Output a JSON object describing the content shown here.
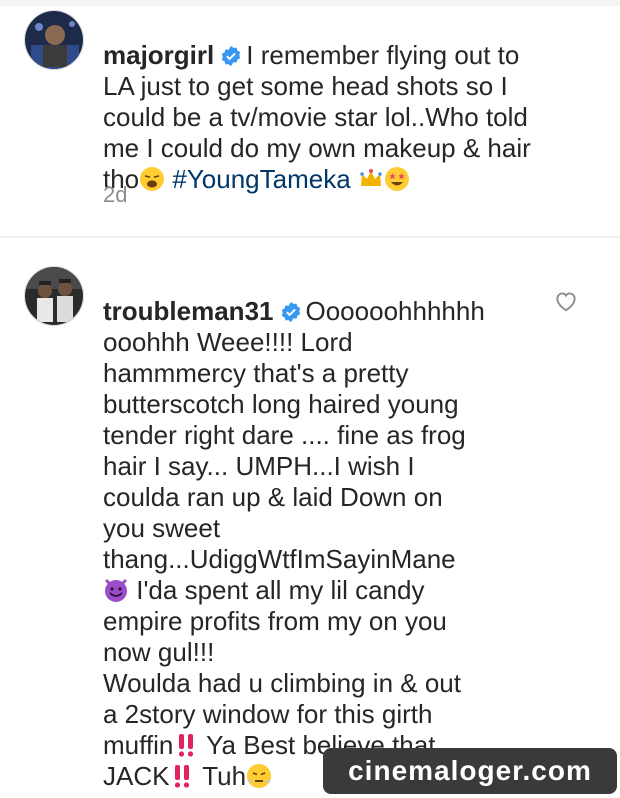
{
  "comments": [
    {
      "username": "majorgirl",
      "text_before_hashtag": "I remember flying out to\nLA just to get some head shots so I\ncould be a tv/movie star lol..Who told\nme I could do my own makeup & hair\ntho",
      "emoji_after_text": "weary-face",
      "hashtag": "#YoungTameka",
      "trailing_emojis": [
        "crown",
        "star-struck"
      ],
      "timestamp": "2d"
    },
    {
      "username": "troubleman31",
      "text_part1": "Oooooohhhhhh\nooohhh Weee!!!! Lord\nhammmercy that's a pretty\nbutterscotch long haired young\ntender right dare .... fine as frog\nhair I say... UMPH...I wish I\ncoulda ran up & laid Down on\nyou sweet\nthang...UdiggWtfImSayinMane",
      "emoji_devil": "smiling-devil",
      "text_part2": "I'da spent all my lil candy\nempire profits from my on you\nnow gul!!!\nWoulda had u climbing in & out\na 2story window for this girth\nmuffin",
      "emoji_bang1": "double-exclamation",
      "text_part3": "Ya Best believe that\nJACK",
      "emoji_bang2": "double-exclamation",
      "text_part4": "Tuh",
      "emoji_end": "face-with-steam"
    }
  ],
  "watermark": "cinemaloger.com",
  "colors": {
    "verified": "#3897f0",
    "hashtag": "#00376b",
    "timestamp": "#8e8e8e"
  }
}
